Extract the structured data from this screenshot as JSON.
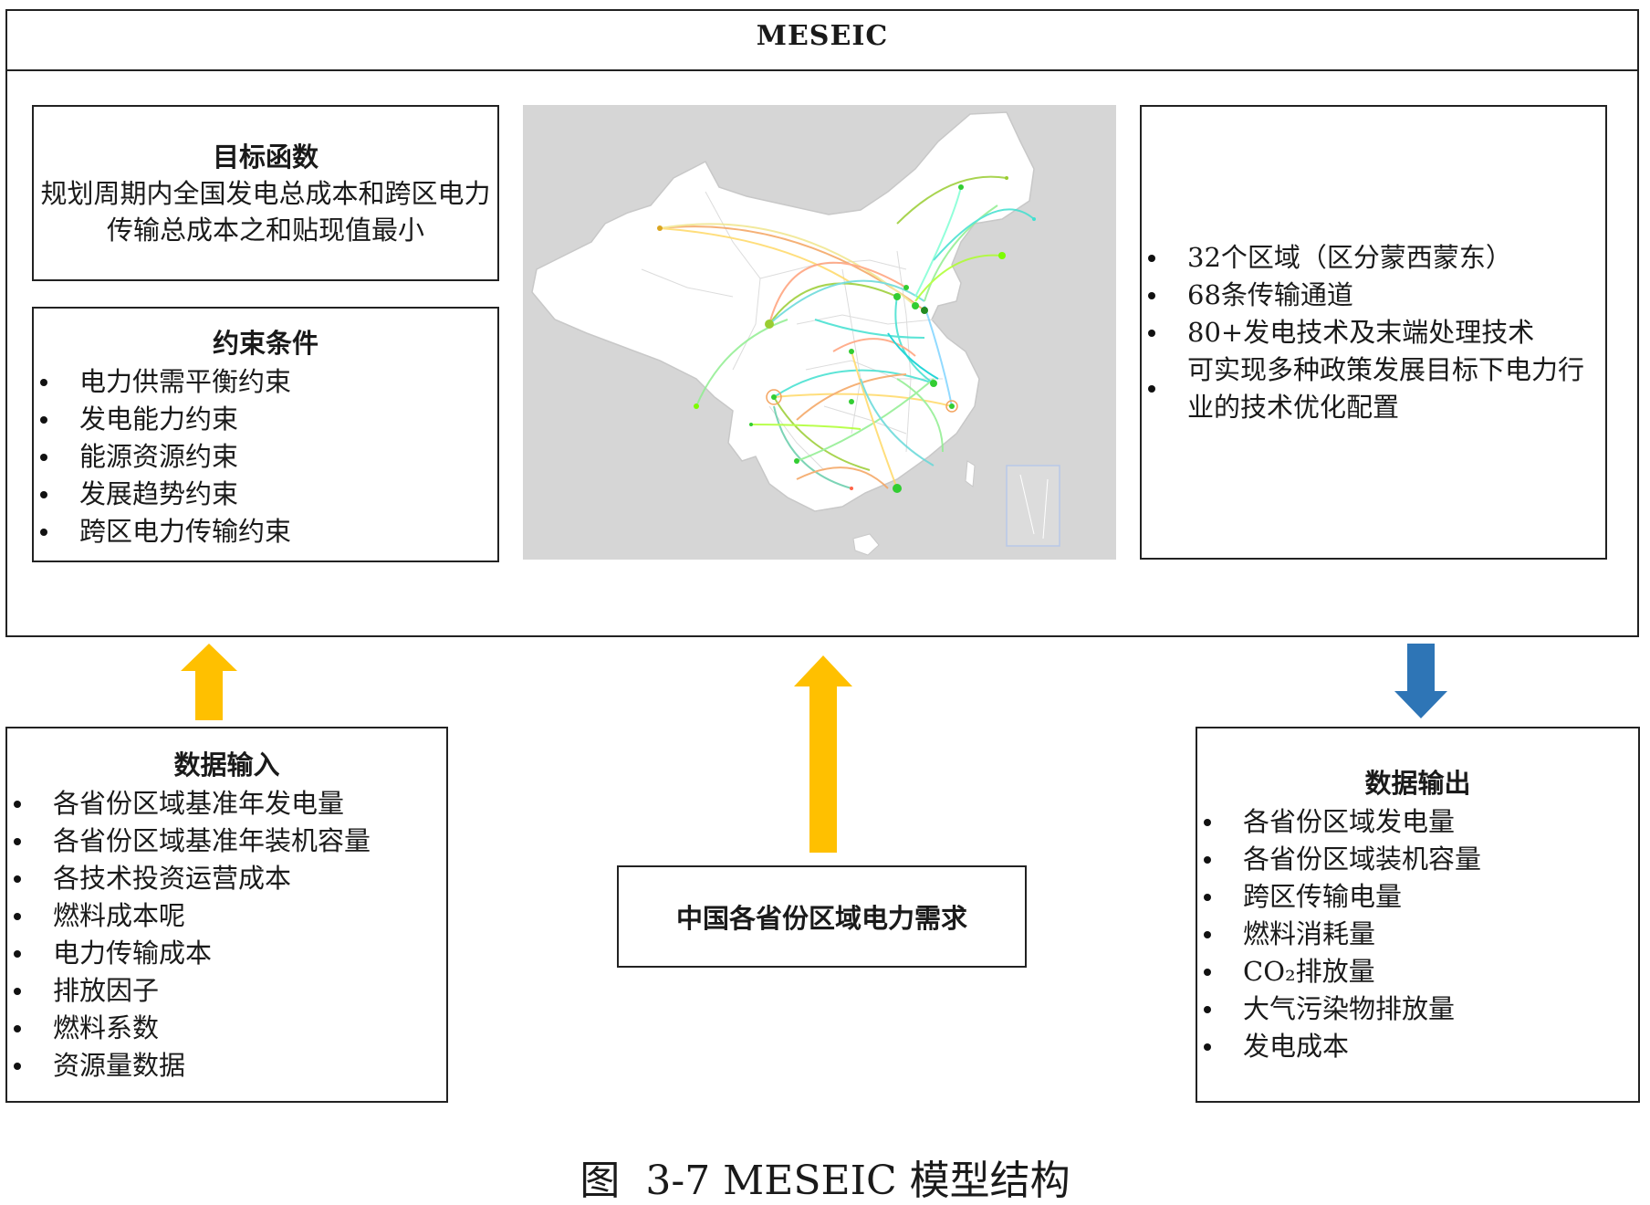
{
  "header": {
    "title": "MESEIC"
  },
  "objective": {
    "title": "目标函数",
    "text": "规划周期内全国发电总成本和跨区电力传输总成本之和贴现值最小"
  },
  "constraints": {
    "title": "约束条件",
    "items": [
      "电力供需平衡约束",
      "发电能力约束",
      "能源资源约束",
      "发展趋势约束",
      "跨区电力传输约束"
    ]
  },
  "features": {
    "items": [
      "32个区域（区分蒙西蒙东）",
      "68条传输通道",
      "80+发电技术及末端处理技术",
      "可实现多种政策发展目标下电力行业的技术优化配置"
    ]
  },
  "data_input": {
    "title": "数据输入",
    "items": [
      "各省份区域基准年发电量",
      "各省份区域基准年装机容量",
      "各技术投资运营成本",
      "燃料成本呢",
      "电力传输成本",
      "排放因子",
      "燃料系数",
      "资源量数据"
    ]
  },
  "demand": {
    "label": "中国各省份区域电力需求"
  },
  "data_output": {
    "title": "数据输出",
    "items": [
      "各省份区域发电量",
      "各省份区域装机容量",
      "跨区传输电量",
      "燃料消耗量",
      "CO₂排放量",
      "大气污染物排放量",
      "发电成本"
    ]
  },
  "caption": "图  3-7 MESEIC 模型结构",
  "colors": {
    "input_arrow": "#ffc000",
    "output_arrow": "#2e75b6",
    "map_background": "#d6d6d6",
    "map_land": "#ffffff"
  }
}
